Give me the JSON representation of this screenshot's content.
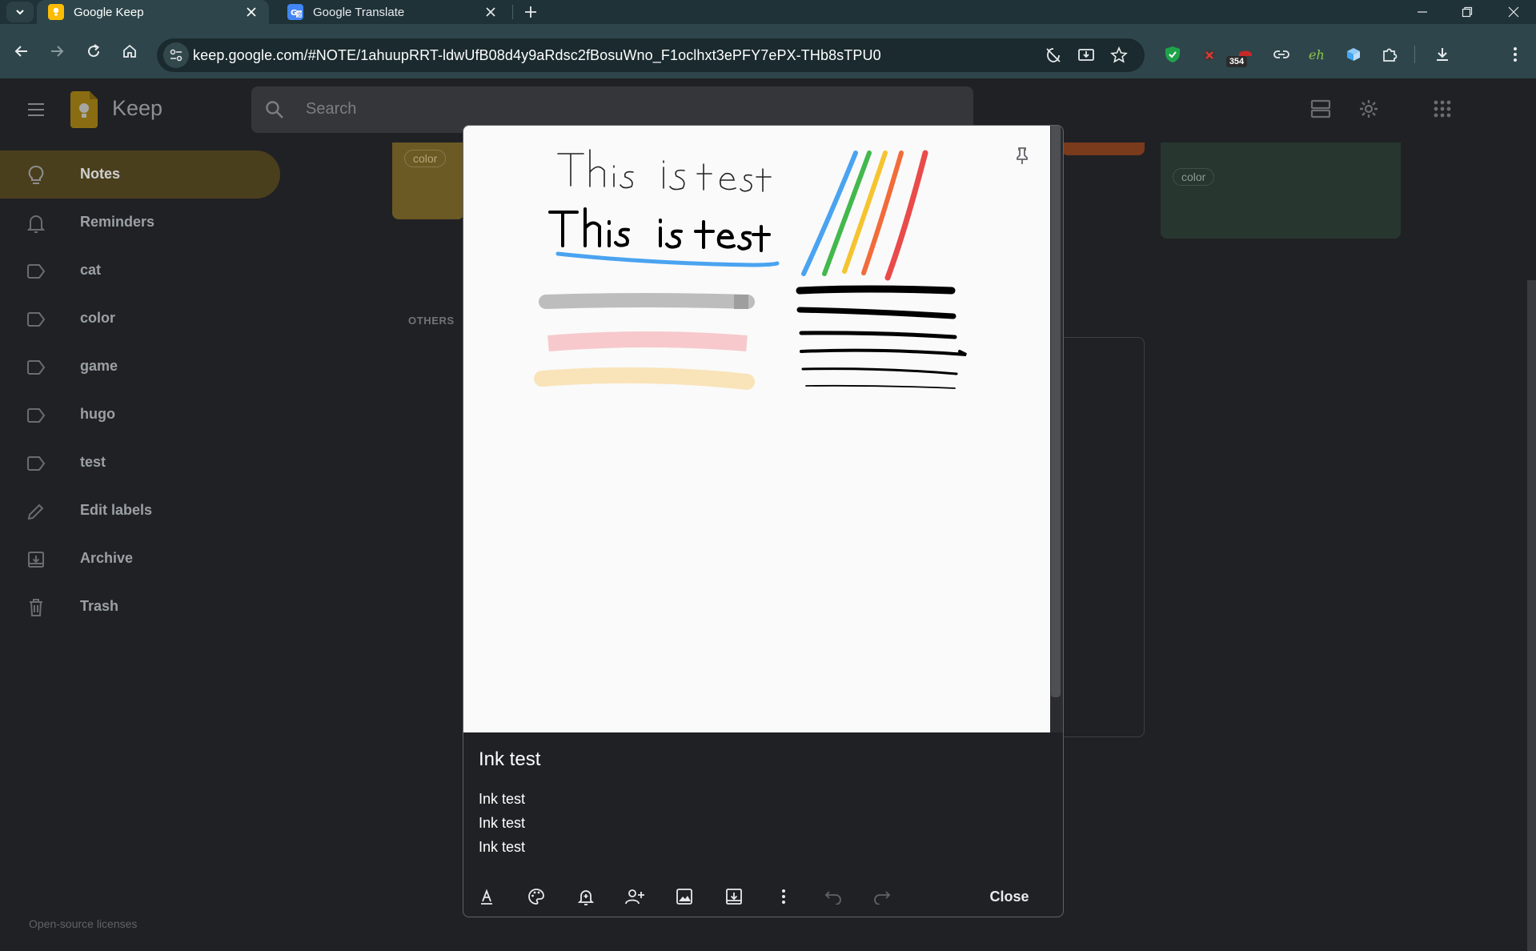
{
  "browser": {
    "tabs": [
      {
        "title": "Google Keep",
        "favicon": "keep-favicon",
        "active": true
      },
      {
        "title": "Google Translate",
        "favicon": "translate-favicon",
        "active": false
      }
    ],
    "url": "keep.google.com/#NOTE/1ahuupRRT-ldwUfB08d4y9aRdsc2fBosuWno_F1oclhxt3ePFY7ePX-THb8sTPU0",
    "extension_badge": "354"
  },
  "app": {
    "name": "Keep",
    "search_placeholder": "Search",
    "nav": [
      {
        "label": "Notes",
        "icon": "lightbulb-icon",
        "active": true
      },
      {
        "label": "Reminders",
        "icon": "bell-icon"
      },
      {
        "label": "cat",
        "icon": "label-icon"
      },
      {
        "label": "color",
        "icon": "label-icon"
      },
      {
        "label": "game",
        "icon": "label-icon"
      },
      {
        "label": "hugo",
        "icon": "label-icon"
      },
      {
        "label": "test",
        "icon": "label-icon"
      },
      {
        "label": "Edit labels",
        "icon": "pencil-icon"
      },
      {
        "label": "Archive",
        "icon": "archive-icon"
      },
      {
        "label": "Trash",
        "icon": "trash-icon"
      }
    ],
    "footer_link": "Open-source licenses",
    "background": {
      "chip_left": "color",
      "chip_right": "color",
      "section_label": "OTHERS"
    }
  },
  "note": {
    "title": "Ink test",
    "lines": [
      "Ink test",
      "Ink test",
      "Ink test"
    ],
    "close_label": "Close",
    "drawing_colors": {
      "blue": "#4aa3f0",
      "green": "#43b84c",
      "yellow": "#f4c430",
      "orange": "#f26b3a",
      "red": "#ea4a4a",
      "gray": "#bdbdbd",
      "pink": "#f7c9cc",
      "cream": "#f9e3b8",
      "ink": "#000000"
    },
    "toolbar_icons": [
      "text-format-icon",
      "palette-icon",
      "reminder-icon",
      "collaborator-icon",
      "image-icon",
      "archive-icon",
      "more-icon",
      "undo-icon",
      "redo-icon"
    ]
  }
}
